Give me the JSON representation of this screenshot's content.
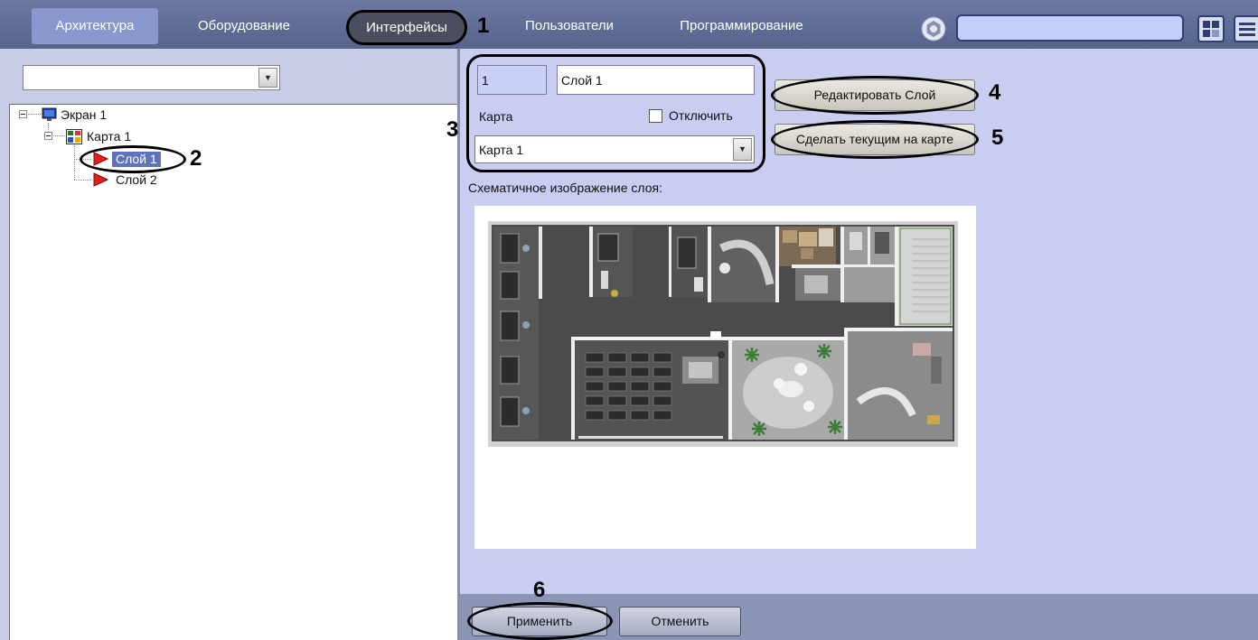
{
  "header": {
    "tabs": [
      {
        "label": "Архитектура",
        "active": true
      },
      {
        "label": "Оборудование",
        "active": false
      },
      {
        "label": "Интерфейсы",
        "active": false
      },
      {
        "label": "Пользователи",
        "active": false
      },
      {
        "label": "Программирование",
        "active": false
      }
    ],
    "search_value": "",
    "icons": {
      "settings": "settings-icon",
      "layout": "grid-layout-icon",
      "menu": "menu-icon"
    }
  },
  "left_panel": {
    "filter_dropdown_value": "",
    "tree": {
      "screen": {
        "label": "Экран 1",
        "icon": "monitor-icon"
      },
      "map": {
        "label": "Карта 1",
        "icon": "map-icon"
      },
      "layers": [
        {
          "label": "Слой 1",
          "selected": true,
          "icon": "layer-arrow-icon"
        },
        {
          "label": "Слой 2",
          "selected": false,
          "icon": "layer-arrow-icon"
        }
      ]
    }
  },
  "layer_form": {
    "id_value": "1",
    "name_value": "Слой 1",
    "map_label": "Карта",
    "disable_label": "Отключить",
    "disable_checked": false,
    "map_select_value": "Карта 1"
  },
  "actions": {
    "edit_layer": "Редактировать Слой",
    "make_current": "Сделать текущим на карте"
  },
  "preview": {
    "label": "Схематичное изображение слоя:"
  },
  "footer": {
    "apply": "Применить",
    "cancel": "Отменить"
  },
  "annotations": [
    "1",
    "2",
    "3",
    "4",
    "5",
    "6"
  ],
  "colors": {
    "header_bg": "#5f6c95",
    "active_tab_bg": "#8997cf",
    "panel_bg": "#c9cdf1",
    "selection_bg": "#6072bd",
    "annotation": "#000000"
  }
}
